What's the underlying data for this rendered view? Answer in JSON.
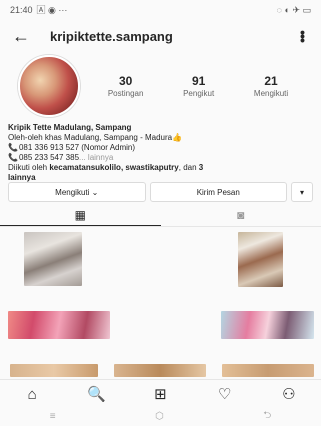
{
  "status": {
    "time": "21:40",
    "left_icons": "🄰 ◉ ···",
    "right_icons": "◌ ◐ ✈ ▭"
  },
  "header": {
    "back_icon": "←",
    "username": "kripiktette.sampang",
    "more_icon": "⋮"
  },
  "stats": [
    {
      "value": "30",
      "label": "Postingan"
    },
    {
      "value": "91",
      "label": "Pengikut"
    },
    {
      "value": "21",
      "label": "Mengikuti"
    }
  ],
  "bio": {
    "name": "Kripik Tette Madulang, Sampang",
    "line1": "Oleh-oleh khas Madulang, Sampang - Madura👍",
    "phone1": "081 336 913 527 (Nomor Admin)",
    "phone2": "085 233 547 385",
    "phone2_more": "... lainnya",
    "followed_prefix": "Diikuti oleh ",
    "followed_names": "kecamatansukolilo, swastikaputry",
    "followed_sep": ", dan ",
    "followed_count": "3",
    "followed_suffix": "lainnya"
  },
  "actions": {
    "follow_label": "Mengikuti ⌄",
    "message_label": "Kirim Pesan",
    "more_label": "▾"
  },
  "tabs": {
    "grid_icon": "▦",
    "tagged_icon": "◙"
  },
  "nav": {
    "home_icon": "⌂",
    "search_icon": "🔍",
    "add_icon": "⊞",
    "heart_icon": "♡",
    "profile_icon": "⚇"
  },
  "sysnav": {
    "menu_icon": "≡",
    "home_icon": "⬡",
    "back_icon": "⮌"
  }
}
